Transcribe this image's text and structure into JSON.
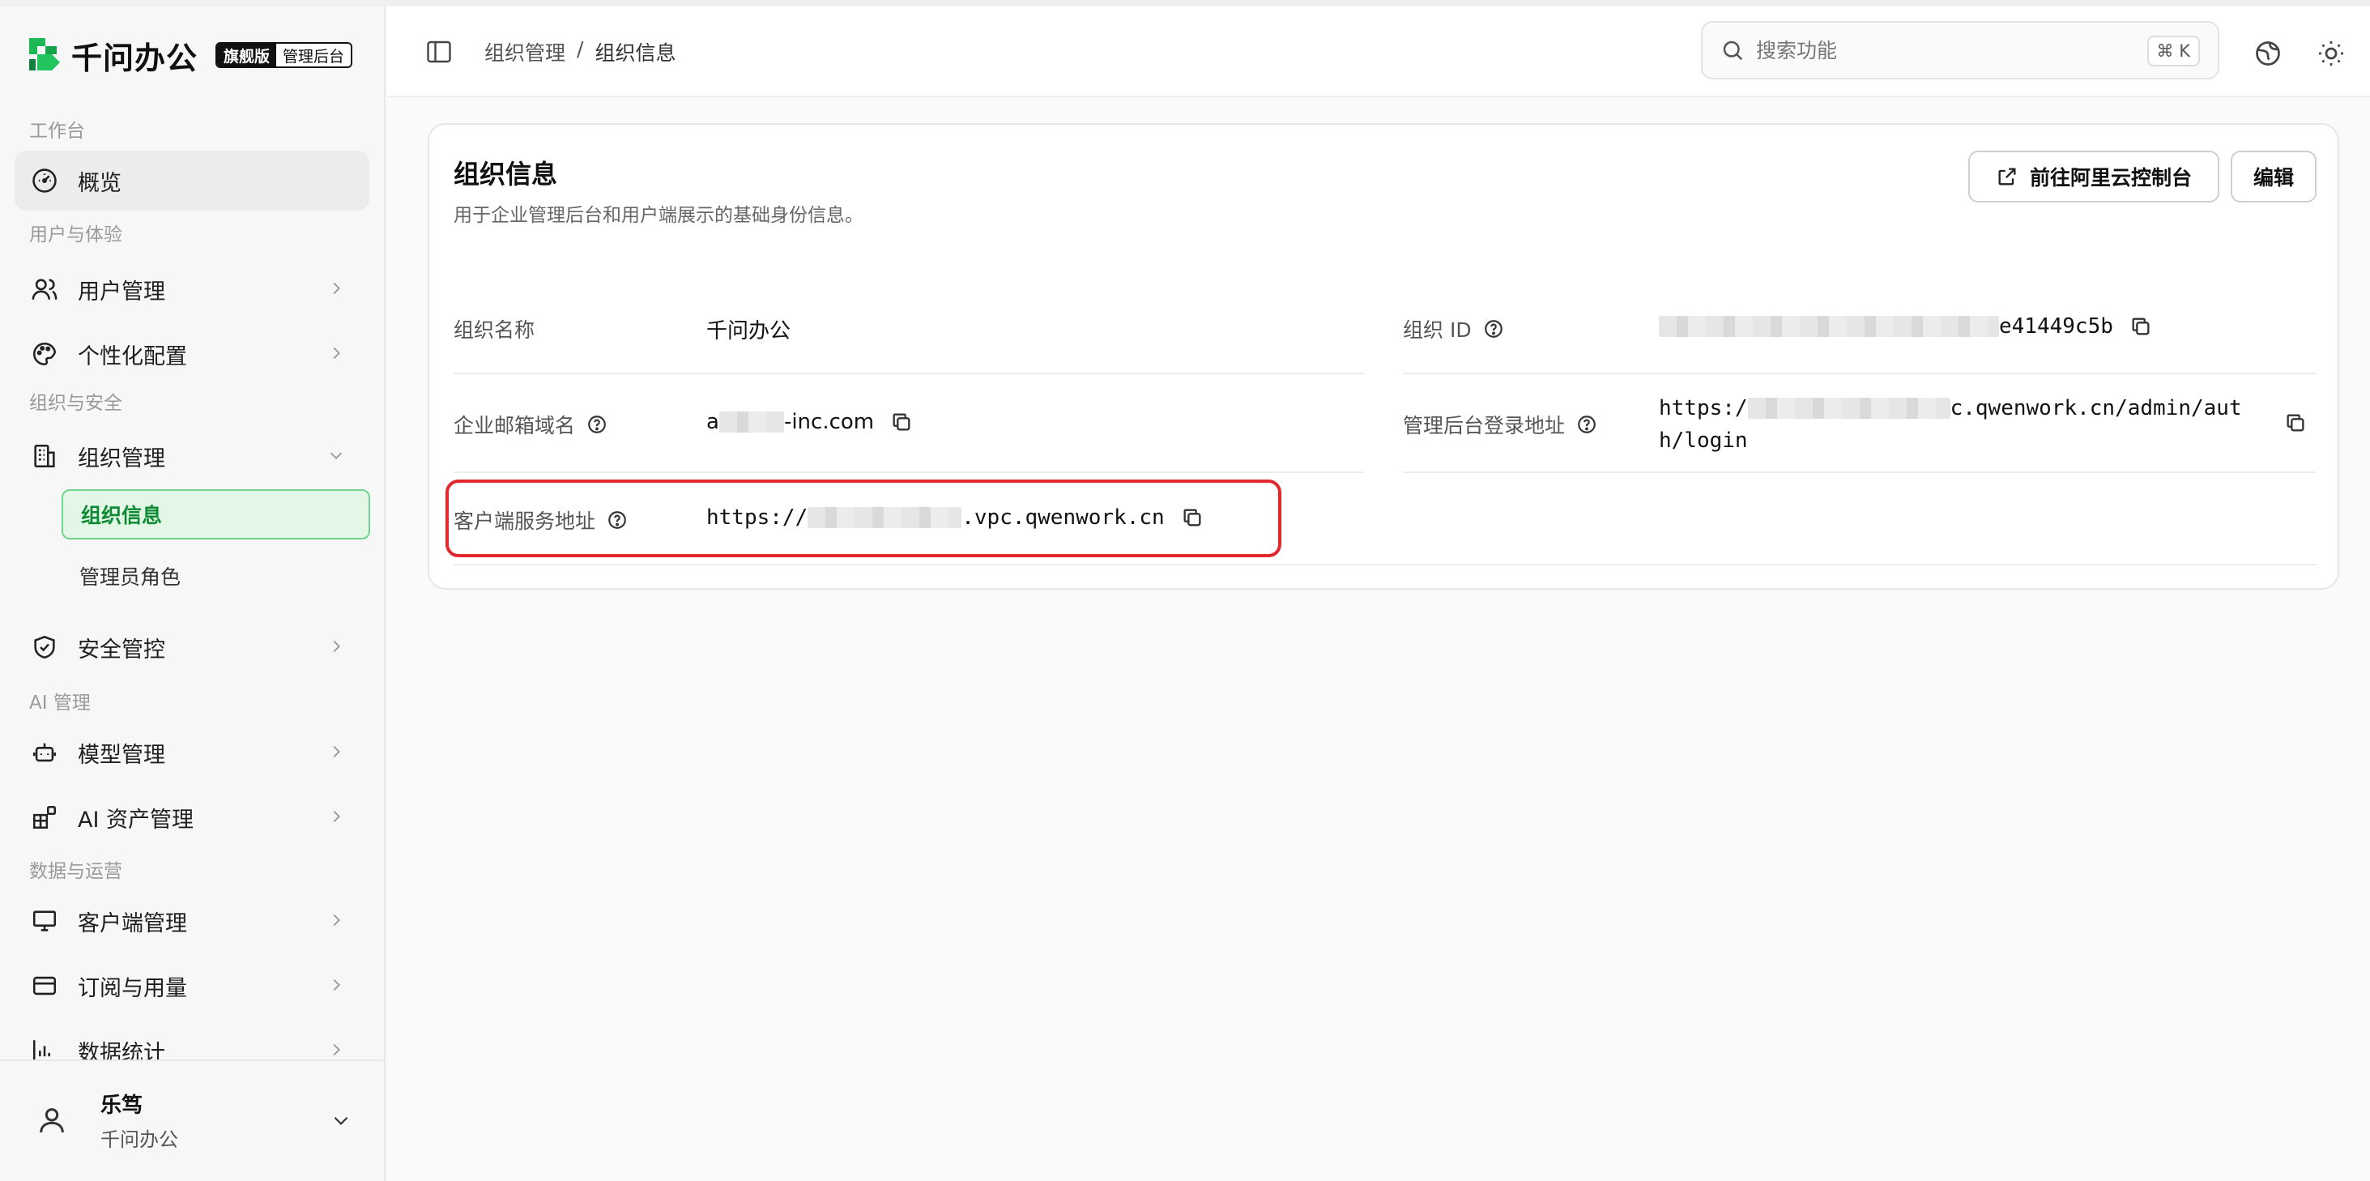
{
  "app": {
    "logo_text": "千问办公",
    "badge_edition": "旗舰版",
    "badge_console": "管理后台"
  },
  "sidebar": {
    "groups": {
      "workbench": "工作台",
      "user_experience": "用户与体验",
      "org_security": "组织与安全",
      "ai_management": "AI 管理",
      "data_ops": "数据与运营"
    },
    "items": {
      "overview": "概览",
      "user_management": "用户管理",
      "personalization": "个性化配置",
      "org_management": "组织管理",
      "org_info": "组织信息",
      "admin_roles": "管理员角色",
      "security": "安全管控",
      "model_management": "模型管理",
      "ai_assets": "AI 资产管理",
      "client_management": "客户端管理",
      "subscription": "订阅与用量",
      "statistics": "数据统计"
    },
    "user": {
      "name": "乐笃",
      "org": "千问办公"
    }
  },
  "header": {
    "breadcrumb_parent": "组织管理",
    "breadcrumb_sep": "/",
    "breadcrumb_current": "组织信息",
    "search_placeholder": "搜索功能",
    "search_shortcut": "⌘ K"
  },
  "card": {
    "title": "组织信息",
    "description": "用于企业管理后台和用户端展示的基础身份信息。",
    "btn_console": "前往阿里云控制台",
    "btn_edit": "编辑",
    "fields": {
      "org_name_label": "组织名称",
      "org_name_value": "千问办公",
      "org_id_label": "组织 ID",
      "org_id_value_suffix": "e41449c5b",
      "email_domain_label": "企业邮箱域名",
      "email_domain_prefix": "a",
      "email_domain_suffix": "-inc.com",
      "admin_url_label": "管理后台登录地址",
      "admin_url_prefix": "https:/",
      "admin_url_suffix": "c.qwenwork.cn/admin/aut",
      "admin_url_line2": "h/login",
      "client_url_label": "客户端服务地址",
      "client_url_prefix": "https://",
      "client_url_suffix": ".vpc.qwenwork.cn"
    }
  },
  "colors": {
    "accent_green": "#0d8a33",
    "highlight_red": "#e0282e"
  }
}
